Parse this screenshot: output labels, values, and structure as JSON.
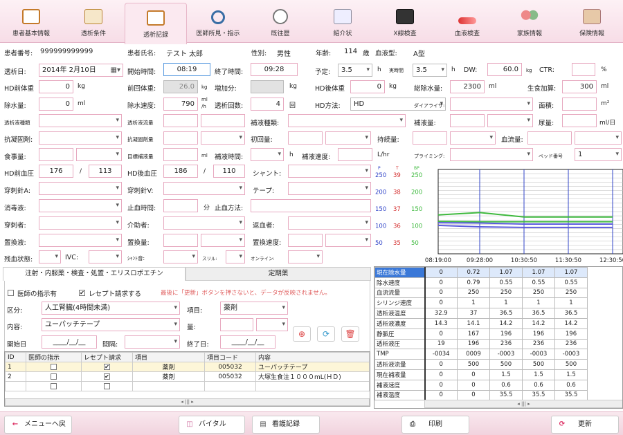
{
  "tabs": [
    {
      "label": "患者基本情報",
      "icon": "patient-doc-icon",
      "cls": "doc"
    },
    {
      "label": "透析条件",
      "icon": "clipboard-pen-icon",
      "cls": "pen"
    },
    {
      "label": "透析記録",
      "icon": "record-doc-icon",
      "cls": "doc",
      "active": true
    },
    {
      "label": "医師所見・指示",
      "icon": "stethoscope-icon",
      "cls": "steth"
    },
    {
      "label": "既往歴",
      "icon": "clock-icon",
      "cls": "clock"
    },
    {
      "label": "紹介状",
      "icon": "letter-icon",
      "cls": "card"
    },
    {
      "label": "X線検査",
      "icon": "xray-icon",
      "cls": "xray"
    },
    {
      "label": "血液検査",
      "icon": "blood-tube-icon",
      "cls": "tube"
    },
    {
      "label": "家族情報",
      "icon": "family-icon",
      "cls": "fam"
    },
    {
      "label": "保険情報",
      "icon": "insurance-card-icon",
      "cls": "ins"
    }
  ],
  "patient": {
    "id_label": "患者番号:",
    "id": "999999999999",
    "name_label": "患者氏名:",
    "name": "テスト 太郎",
    "sex_label": "性別:",
    "sex": "男性",
    "age_label": "年齢:",
    "age": "114",
    "age_unit": "歳",
    "blood_label": "血液型:",
    "blood": "A型"
  },
  "form": {
    "date_label": "透析日:",
    "date": "2014年  2月10日",
    "start_label": "開始時間:",
    "start": "08:19",
    "end_label": "終了時間:",
    "end": "09:28",
    "plan_label": "予定:",
    "plan": "3.5",
    "h1": "h",
    "actual_label": "実時間",
    "actual": "3.5",
    "h2": "h",
    "dw_label": "DW:",
    "dw": "60.0",
    "kg": "kg",
    "ctr_label": "CTR:",
    "pct": "%",
    "pre_w_label": "HD前体重",
    "pre_w": "0",
    "prev_w_label": "前回体重:",
    "prev_w": "26.0",
    "inc_label": "増加分:",
    "post_w_label": "HD後体重",
    "post_w": "0",
    "total_rm_label": "総除水量:",
    "total_rm": "2300",
    "ml": "ml",
    "saline_label": "生食加算:",
    "saline": "300",
    "rm_label": "除水量:",
    "rm": "0",
    "speed_label": "除水速度:",
    "speed": "790",
    "speed_unit_top": "ml",
    "speed_unit_bot": "/h",
    "count_label": "透析回数:",
    "count": "4",
    "count_unit": "回",
    "method_label": "HD方法:",
    "method": "HD",
    "dializer_label": "ダイアライザ:",
    "area_label": "面積:",
    "area_unit": "m²",
    "fluid_type_label": "透析液種類",
    "fluid_flow_label": "透析液流量",
    "supp_type_label": "補液種類:",
    "supp_vol_label": "補液量:",
    "urine_label": "尿量:",
    "urine_unit": "ml/日",
    "anticoag_label": "抗凝固剤:",
    "anticoag_q_label": "抗凝固剤量",
    "first_label": "初回量:",
    "cont_label": "持続量:",
    "bflow_label": "血流量:",
    "meal_label": "食事量:",
    "target_label": "目標補液量",
    "ml2": "ml",
    "supp_time_label": "補液時間:",
    "h3": "h",
    "supp_speed_label": "補液速度:",
    "lhr": "L/hr",
    "priming_label": "プライミング:",
    "bed_label": "ベッド番号",
    "bed": "1",
    "pre_bp_label": "HD前血圧",
    "pre_bp_s": "176",
    "pre_bp_d": "113",
    "slash": "/",
    "post_bp_label": "HD後血圧",
    "post_bp_s": "186",
    "post_bp_d": "110",
    "shunt_label": "シャント:",
    "needle_a_label": "穿刺針A:",
    "needle_v_label": "穿刺針V:",
    "tape_label": "テープ:",
    "disinf_label": "消毒液:",
    "stop_time_label": "止血時間:",
    "min": "分",
    "stop_method_label": "止血方法:",
    "puncture_label": "穿刺者:",
    "assist_label": "介助者:",
    "return_label": "返血者:",
    "replace_label": "置換液:",
    "replace_q_label": "置換量:",
    "replace_s_label": "置換速度:",
    "residual_label": "残血状態:",
    "ivc_label": "IVC:",
    "shunt_sound_label": "ｼｬﾝﾄ音:",
    "thrill_label": "スリル:",
    "online_label": "オンライン:"
  },
  "chart_data": {
    "type": "line",
    "axes_labels": {
      "p": "P",
      "t": "T",
      "bp": "BP"
    },
    "y_ticks": {
      "p": [
        "250",
        "200",
        "150",
        "100",
        "50"
      ],
      "t": [
        "39",
        "38",
        "37",
        "36",
        "35"
      ],
      "bp": [
        "250",
        "200",
        "150",
        "100",
        "50"
      ]
    },
    "x": [
      "08:19:00",
      "09:28:00",
      "10:30:50",
      "11:30:50",
      "12:30:50"
    ],
    "series": [
      {
        "color": "#3eb93e",
        "values": [
          130,
          137,
          124,
          124,
          124
        ]
      },
      {
        "color": "#3eb93e",
        "values": [
          111,
          110,
          110,
          110,
          110
        ]
      },
      {
        "color": "#5b5bdc",
        "values": [
          107,
          106,
          103,
          103,
          103
        ]
      },
      {
        "color": "#5b5bdc",
        "values": [
          99,
          95,
          93,
          93,
          93
        ]
      }
    ]
  },
  "grid": {
    "rows": [
      {
        "label": "現在除水量",
        "v": [
          "0",
          "0.72",
          "1.07",
          "1.07",
          "1.07"
        ]
      },
      {
        "label": "除水速度",
        "v": [
          "0",
          "0.79",
          "0.55",
          "0.55",
          "0.55"
        ]
      },
      {
        "label": "血流流量",
        "v": [
          "0",
          "250",
          "250",
          "250",
          "250"
        ]
      },
      {
        "label": "シリンジ速度",
        "v": [
          "0",
          "1",
          "1",
          "1",
          "1"
        ]
      },
      {
        "label": "透析液温度",
        "v": [
          "32.9",
          "37",
          "36.5",
          "36.5",
          "36.5"
        ]
      },
      {
        "label": "透析液濃度",
        "v": [
          "14.3",
          "14.1",
          "14.2",
          "14.2",
          "14.2"
        ]
      },
      {
        "label": "静脈圧",
        "v": [
          "0",
          "167",
          "196",
          "196",
          "196"
        ]
      },
      {
        "label": "透析液圧",
        "v": [
          "19",
          "196",
          "236",
          "236",
          "236"
        ]
      },
      {
        "label": "TMP",
        "v": [
          "-0034",
          "0009",
          "-0003",
          "-0003",
          "-0003"
        ]
      },
      {
        "label": "透析液流量",
        "v": [
          "0",
          "500",
          "500",
          "500",
          "500"
        ]
      },
      {
        "label": "現在補液量",
        "v": [
          "0",
          "0",
          "1.5",
          "1.5",
          "1.5"
        ]
      },
      {
        "label": "補液速度",
        "v": [
          "0",
          "0",
          "0.6",
          "0.6",
          "0.6"
        ]
      },
      {
        "label": "補液温度",
        "v": [
          "0",
          "0",
          "35.5",
          "35.5",
          "35.5"
        ]
      }
    ]
  },
  "lower": {
    "tab1": "注射・内服薬・検査・処置・エリスロポエチン",
    "tab2": "定期薬",
    "doctor_check": "医師の指示有",
    "receipt_check": "レセプト請求する",
    "warning": "最後に「更新」ボタンを押さないと、データが反映されません。",
    "cat_label": "区分:",
    "cat": "人工腎臓(4時間未満)",
    "item_label": "項目:",
    "item": "薬剤",
    "content_label": "内容:",
    "content": "ユーパッチテープ",
    "qty_label": "量:",
    "start_label": "開始日",
    "start": "____/__/__",
    "interval_label": "間隔:",
    "end_label": "終了日:",
    "end": "____/__/__",
    "cols": [
      "ID",
      "医師の指示",
      "レセプト請求",
      "項目",
      "項目コード",
      "内容"
    ],
    "rows": [
      {
        "id": "1",
        "item": "薬剤",
        "code": "005032",
        "content": "ユーパッチテープ"
      },
      {
        "id": "2",
        "item": "薬剤",
        "code": "005032",
        "content": "大塚生食注１０００mL(ＨＤ)"
      },
      {
        "id": "",
        "item": "",
        "code": "",
        "content": ""
      }
    ]
  },
  "bottom": {
    "back": "メニューへ戻る",
    "vital": "バイタル",
    "nurse": "看護記録",
    "print": "印刷",
    "update": "更新"
  },
  "icons": {
    "back": "arrow-left-icon",
    "vital": "vital-chart-icon",
    "nurse": "nursing-record-icon",
    "print": "printer-icon",
    "update": "refresh-icon",
    "add": "plus-icon",
    "reload": "reload-icon",
    "trash": "trash-icon",
    "calendar": "calendar-icon"
  }
}
